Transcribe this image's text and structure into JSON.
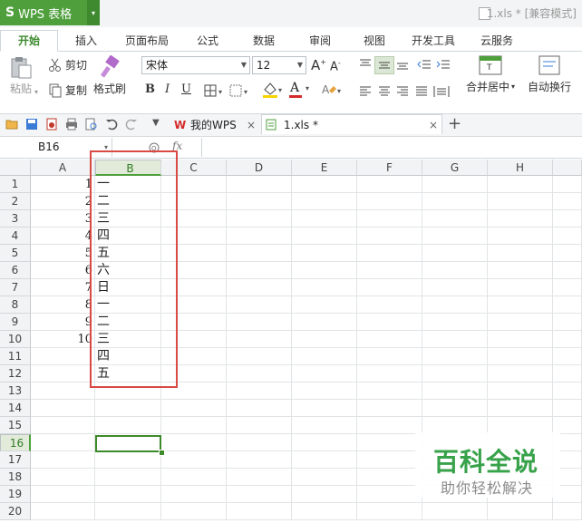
{
  "app": {
    "logo_glyph": "S",
    "name": "WPS 表格",
    "dropdown_glyph": "▾",
    "window_title": "1.xls * [兼容模式]"
  },
  "tabs": [
    "开始",
    "插入",
    "页面布局",
    "公式",
    "数据",
    "审阅",
    "视图",
    "开发工具",
    "云服务"
  ],
  "active_tab": "开始",
  "ribbon": {
    "paste": "粘贴",
    "cut": "剪切",
    "copy": "复制",
    "format_painter": "格式刷",
    "font_name": "宋体",
    "font_size": "12",
    "grow_font": "A",
    "shrink_font": "A",
    "bold": "B",
    "italic": "I",
    "underline": "U",
    "font_color_glyph": "A",
    "merge_center": "合并居中",
    "wrap_text": "自动换行",
    "accent_color": "#4f9f3d",
    "font_color": "#d42a2a",
    "fill_color": "#f5d400"
  },
  "quick_access": {
    "doc_tabs": [
      {
        "label": "我的WPS",
        "close": "×"
      },
      {
        "label": "1.xls *",
        "close": "×"
      }
    ],
    "new_tab": "+"
  },
  "formula_bar": {
    "name_box": "B16",
    "fx": "fx",
    "formula": ""
  },
  "sheet": {
    "columns": [
      "A",
      "B",
      "C",
      "D",
      "E",
      "F",
      "G",
      "H"
    ],
    "rows": [
      "1",
      "2",
      "3",
      "4",
      "5",
      "6",
      "7",
      "8",
      "9",
      "10",
      "11",
      "12",
      "13",
      "14",
      "15",
      "16",
      "17",
      "18",
      "19",
      "20"
    ],
    "selected_cell": "B16",
    "col_a_values": [
      "1",
      "2",
      "3",
      "4",
      "5",
      "6",
      "7",
      "8",
      "9",
      "10"
    ],
    "col_b_values": [
      "一",
      "二",
      "三",
      "四",
      "五",
      "六",
      "日",
      "一",
      "二",
      "三",
      "四",
      "五"
    ]
  },
  "watermark": {
    "title": "百科全说",
    "subtitle": "助你轻松解决"
  }
}
